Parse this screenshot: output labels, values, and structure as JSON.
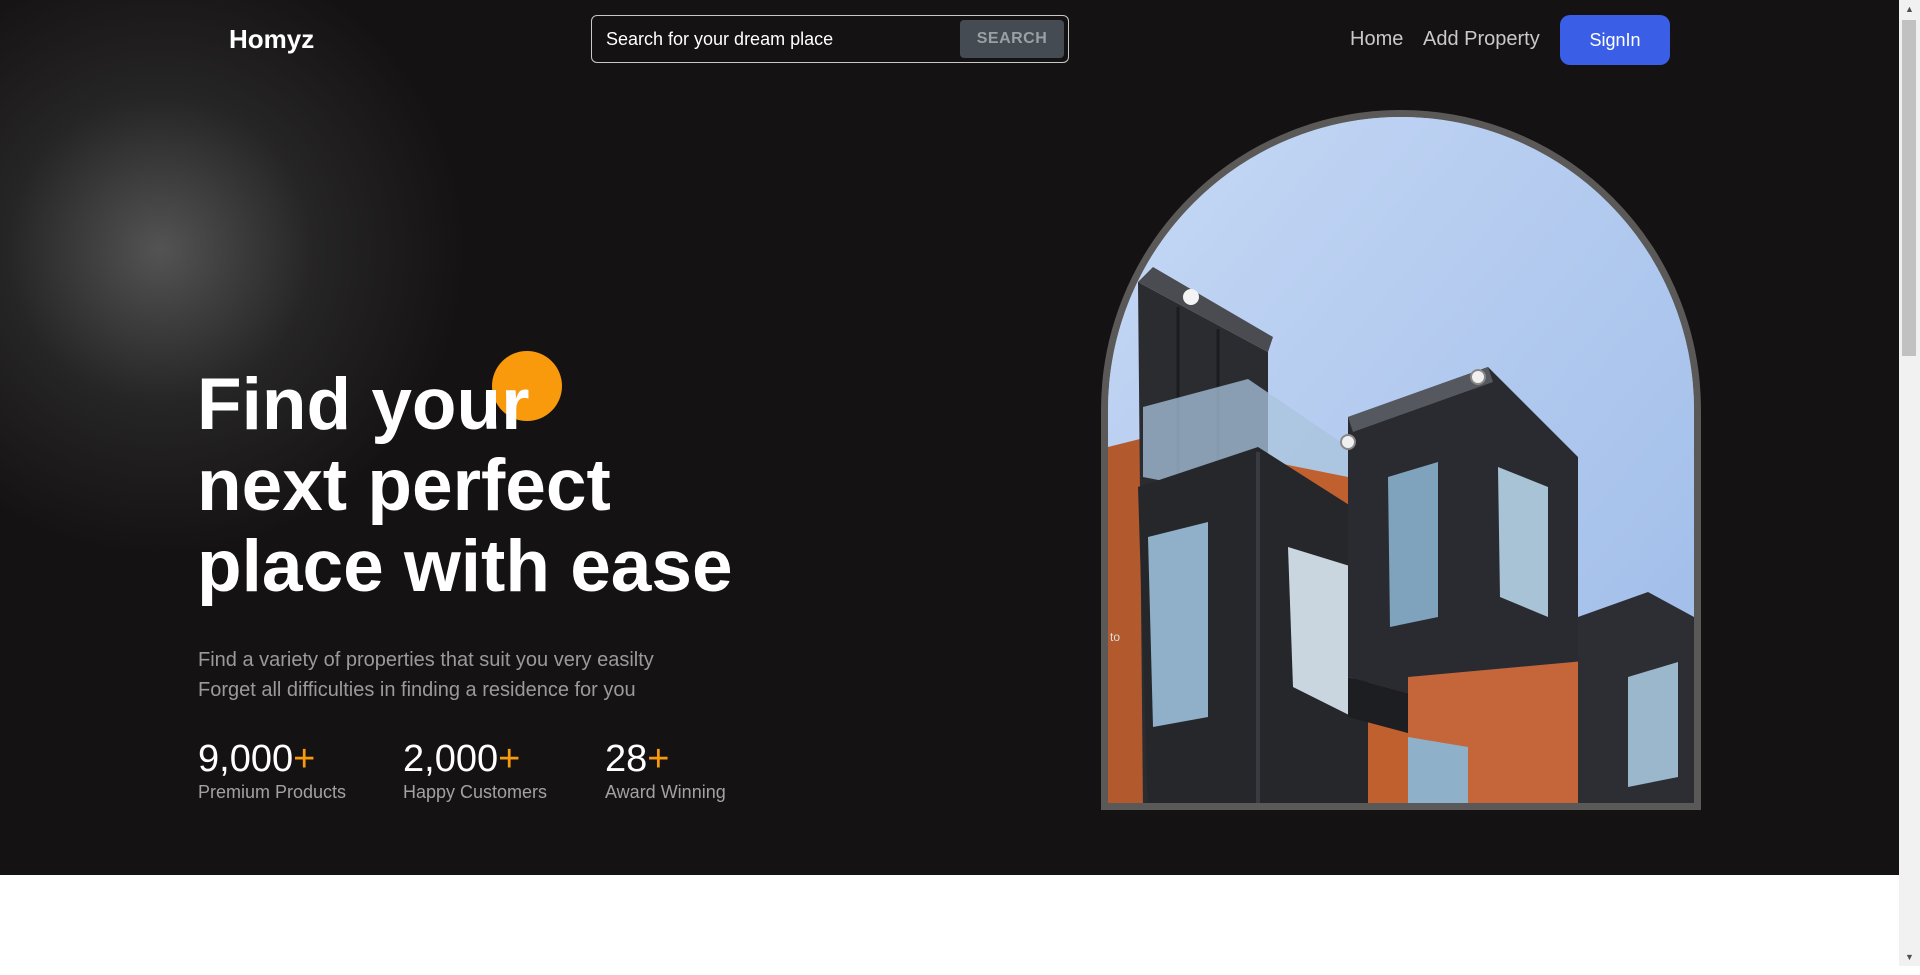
{
  "brand": {
    "name": "Homyz"
  },
  "search": {
    "placeholder": "Search for your dream place",
    "button_label": "SEARCH"
  },
  "nav": {
    "items": [
      {
        "label": "Home"
      },
      {
        "label": "Add Property"
      }
    ],
    "signin_label": "SignIn"
  },
  "hero": {
    "title_lines": [
      "Find your",
      "next perfect",
      "place with ease"
    ],
    "subtitle_lines": [
      "Find a variety of properties that suit you very easilty",
      "Forget all difficulties in finding a residence for you"
    ],
    "stats": [
      {
        "value": "9,000",
        "suffix": "+",
        "label": "Premium Products"
      },
      {
        "value": "2,000",
        "suffix": "+",
        "label": "Happy Customers"
      },
      {
        "value": "28",
        "suffix": "+",
        "label": "Award Winning"
      }
    ],
    "image_alt_fragment": "to"
  },
  "colors": {
    "accent": "#f89a0c",
    "primary_button": "#3a5fe6",
    "background": "#141212"
  },
  "icons": {
    "scroll_up": "triangle-up-icon",
    "scroll_down": "triangle-down-icon"
  }
}
